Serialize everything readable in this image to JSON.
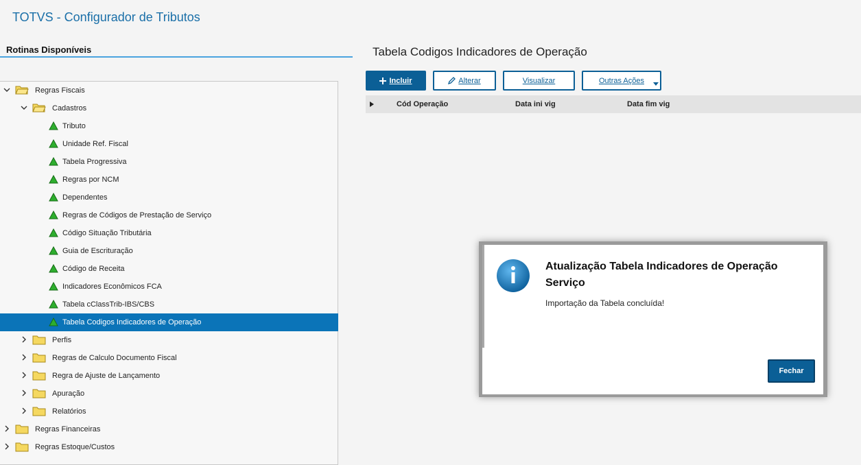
{
  "app": {
    "title": "TOTVS - Configurador de Tributos"
  },
  "left_panel": {
    "title": "Rotinas Disponíveis"
  },
  "tree": [
    {
      "label": "Regras Fiscais",
      "type": "folder",
      "expanded": true
    },
    {
      "label": "Cadastros",
      "type": "folder",
      "expanded": true
    },
    {
      "label": "Tributo",
      "type": "leaf"
    },
    {
      "label": "Unidade Ref. Fiscal",
      "type": "leaf"
    },
    {
      "label": "Tabela Progressiva",
      "type": "leaf"
    },
    {
      "label": "Regras por NCM",
      "type": "leaf"
    },
    {
      "label": "Dependentes",
      "type": "leaf"
    },
    {
      "label": "Regras de Códigos de Prestação de Serviço",
      "type": "leaf"
    },
    {
      "label": "Código Situação Tributária",
      "type": "leaf"
    },
    {
      "label": "Guia de Escrituração",
      "type": "leaf"
    },
    {
      "label": "Código de Receita",
      "type": "leaf"
    },
    {
      "label": "Indicadores Econômicos FCA",
      "type": "leaf"
    },
    {
      "label": "Tabela cClassTrib-IBS/CBS",
      "type": "leaf"
    },
    {
      "label": "Tabela Codigos Indicadores de Operação",
      "type": "leaf",
      "selected": true
    },
    {
      "label": "Perfis",
      "type": "folder",
      "expanded": false
    },
    {
      "label": "Regras de Calculo Documento Fiscal",
      "type": "folder",
      "expanded": false
    },
    {
      "label": "Regra de Ajuste de Lançamento",
      "type": "folder",
      "expanded": false
    },
    {
      "label": "Apuração",
      "type": "folder",
      "expanded": false
    },
    {
      "label": "Relatórios",
      "type": "folder",
      "expanded": false
    },
    {
      "label": "Regras Financeiras",
      "type": "folder",
      "expanded": false
    },
    {
      "label": "Regras Estoque/Custos",
      "type": "folder",
      "expanded": false
    }
  ],
  "main": {
    "title": "Tabela Codigos Indicadores de Operação",
    "buttons": {
      "incluir": "Incluir",
      "alterar": "Alterar",
      "visualizar": "Visualizar",
      "outras": "Outras Ações"
    },
    "columns": [
      "Cód Operação",
      "Data ini vig",
      "Data fim vig"
    ]
  },
  "dialog": {
    "title": "Atualização Tabela Indicadores de Operação Serviço",
    "message": "Importação da Tabela concluída!",
    "close_label": "Fechar"
  },
  "colors": {
    "accent": "#0b5f96",
    "selected_row": "#0b74b8",
    "leaf_icon": "#2eae2e",
    "folder": "#f5d860",
    "title": "#1a6fa8"
  },
  "icons": {
    "expanded": "chevron-down-icon",
    "collapsed": "chevron-right-icon",
    "folder": "folder-icon",
    "leaf": "green-triangle-icon",
    "info": "info-icon",
    "plus": "plus-icon",
    "edit": "pencil-icon",
    "dropdown": "caret-down-icon"
  }
}
